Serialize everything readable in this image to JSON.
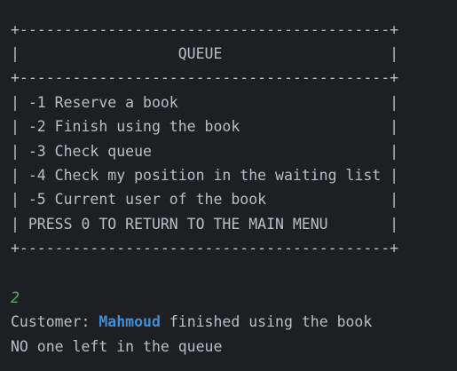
{
  "console": {
    "menu_box": {
      "border_top": "+------------------------------------------+",
      "title_row": "|                  QUEUE                   |",
      "border_mid": "+------------------------------------------+",
      "items": [
        "| -1 Reserve a book                        |",
        "| -2 Finish using the book                 |",
        "| -3 Check queue                           |",
        "| -4 Check my position in the waiting list |",
        "| -5 Current user of the book              |",
        "| PRESS 0 TO RETURN TO THE MAIN MENU       |"
      ],
      "border_bottom": "+------------------------------------------+"
    },
    "user_input": "2",
    "output": {
      "prefix": "Customer: ",
      "customer_name": "Mahmoud",
      "suffix": " finished using the book",
      "status_line": "NO one left in the queue"
    },
    "colors": {
      "background": "#1e1f22",
      "text": "#bcbec4",
      "input_echo": "#5fa56b",
      "highlight_name": "#3f8ed8"
    }
  }
}
